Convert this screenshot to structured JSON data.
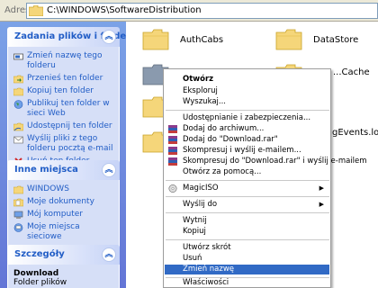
{
  "address_bar": {
    "label": "Adres",
    "path": "C:\\WINDOWS\\SoftwareDistribution"
  },
  "task_pane": {
    "file_tasks": {
      "title": "Zadania plików i folderów",
      "items": [
        "Zmień nazwę tego folderu",
        "Przenieś ten folder",
        "Kopiuj ten folder",
        "Publikuj ten folder w sieci Web",
        "Udostępnij ten folder",
        "Wyślij pliki z tego folderu pocztą e-mail",
        "Usuń ten folder"
      ]
    },
    "other_places": {
      "title": "Inne miejsca",
      "items": [
        "WINDOWS",
        "Moje dokumenty",
        "Mój komputer",
        "Moje miejsca sieciowe"
      ]
    },
    "details": {
      "title": "Szczegóły",
      "name": "Download",
      "type": "Folder plików"
    }
  },
  "folders": {
    "authcabs": "AuthCabs",
    "datastore": "DataStore",
    "partial_right_1": "...Cache",
    "partial_right_2": "gEvents.log"
  },
  "context_menu": {
    "open": "Otwórz",
    "explore": "Eksploruj",
    "search": "Wyszukaj...",
    "sharing": "Udostępnianie i zabezpieczenia...",
    "add_archive": "Dodaj do archiwum...",
    "add_rar": "Dodaj do \"Download.rar\"",
    "compress_email": "Skompresuj i wyślij e-mailem...",
    "compress_rar_email": "Skompresuj do \"Download.rar\" i wyślij e-mailem",
    "open_with": "Otwórz za pomocą...",
    "magiciso": "MagicISO",
    "send_to": "Wyślij do",
    "cut": "Wytnij",
    "copy": "Kopiuj",
    "create_shortcut": "Utwórz skrót",
    "delete": "Usuń",
    "rename": "Zmień nazwę",
    "properties": "Właściwości"
  },
  "colors": {
    "selection": "#316ac5",
    "link": "#215dc6",
    "folder": "#f5d67a"
  }
}
